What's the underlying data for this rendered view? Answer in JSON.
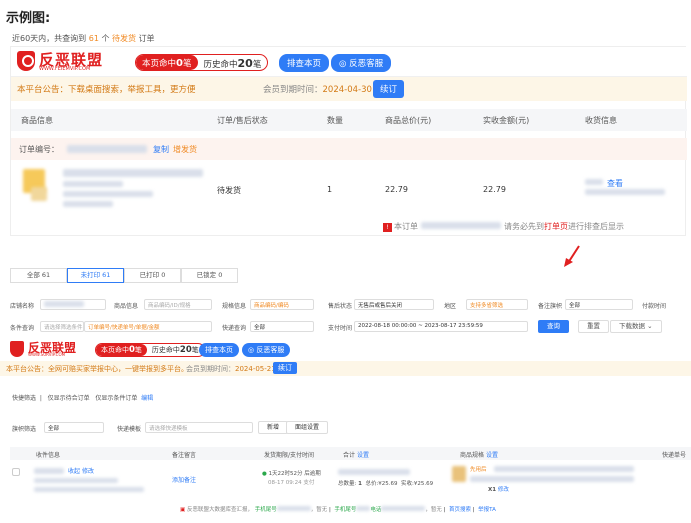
{
  "page_title": "示例图:",
  "summary": {
    "prefix": "近60天内，共查询到",
    "count": "61",
    "middle": "个",
    "status": "待发货",
    "suffix": "订单"
  },
  "brand": {
    "name": "反恶联盟",
    "url": "WWW.FEIEMVIP.COM",
    "accent": "#e02020",
    "blue": "#2f7cf6"
  },
  "hits": {
    "current_prefix": "本页命中",
    "current_count": "0",
    "current_suffix": "笔",
    "history_prefix": "历史命中",
    "history_count": "20",
    "history_suffix": "笔"
  },
  "header_buttons": {
    "check_page": "排查本页",
    "feedback": "反恶客服"
  },
  "notice": {
    "text": "本平台公告：下载桌面搜索，举报工具，更方便",
    "expire_label": "会员到期时间：",
    "expire_date": "2024-04-30",
    "renew": "续订"
  },
  "table_headers": [
    "商品信息",
    "订单/售后状态",
    "数量",
    "商品总价(元)",
    "实收金额(元)",
    "收货信息"
  ],
  "order": {
    "label": "订单编号：",
    "copy": "复制",
    "remark": "增发货",
    "status": "待发货",
    "quantity": "1",
    "total": "22.79",
    "received": "22.79",
    "view": "查看"
  },
  "warning": {
    "prefix": "本订单",
    "middle": "请务必先到",
    "link": "打单页",
    "suffix": "进行排查后显示"
  },
  "tabs": [
    {
      "label": "全部",
      "count": "61"
    },
    {
      "label": "未打印",
      "count": "61"
    },
    {
      "label": "已打印",
      "count": "0"
    },
    {
      "label": "已锁定",
      "count": "0"
    }
  ],
  "filters": {
    "shop_label": "店铺名称",
    "product_label": "商品信息",
    "product_ph": "商品编码/ID/规格",
    "spec_label": "规格信息",
    "spec_ph": "商品编码/编码",
    "refund_label": "售后状态",
    "refund_val": "无售后或售后关闭",
    "region_label": "地区",
    "region_val": "支持多省筛选",
    "remark_label": "备注旗帜",
    "remark_val": "全部",
    "pay_label": "付款时间",
    "cond_label": "条件查询",
    "cond_ph": "请选择筛选条件",
    "cond_val": "订单编号/快递单号/单据/金额",
    "express_label": "快递查询",
    "express_val": "全部",
    "time_label": "支付时间",
    "time_val": "2022-08-18 00:00:00 ~ 2023-08-17 23:59:59",
    "search": "查询",
    "reset": "重置",
    "download": "下载数据"
  },
  "brand2": {
    "name": "反恶联盟",
    "url": "WWW.SURVIP.COM"
  },
  "hits2": {
    "current_prefix": "本页命中",
    "current_count": "0",
    "current_suffix": "笔",
    "history_prefix": "历史命中",
    "history_count": "20",
    "history_suffix": "笔"
  },
  "notice2": {
    "text": "本平台公告：全网可赔买家举报中心，一键举报到多平台。",
    "expire_label": "会员到期时间：",
    "expire_date": "2024-05-21",
    "renew": "续订"
  },
  "filter_tags": {
    "a": "快捷筛选",
    "b": "仅显示待合订单",
    "c": "仅显示条件订单",
    "d": "编辑"
  },
  "list_controls": {
    "flag_label": "旗帜筛选",
    "flag_val": "全部",
    "express_label": "快递模板",
    "express_ph": "请选择快递模板",
    "new": "新增",
    "setting": "面组设置"
  },
  "list_headers": {
    "recv": "收件信息",
    "remark": "备注留言",
    "time": "发货期限/支付时间",
    "total": "合计",
    "total_set": "设置",
    "goods": "商品规格",
    "goods_set": "设置",
    "express": "快递单号"
  },
  "list_row": {
    "edit1": "收起",
    "edit2": "修改",
    "add_remark": "添加备注",
    "deadline": "1天22时52分 后逾期",
    "paytime": "08-17 09:24 支付",
    "total_prefix": "总数量:",
    "total_qty": "1",
    "total_pay_label": "总价:",
    "total_pay": "¥25.69",
    "received_label": "实收:",
    "received": "¥25.69",
    "goods_tag": "先用后",
    "goods_qty": "X1",
    "goods_edit": "修改"
  },
  "bottom": {
    "a": "反恶联盟大数据库查汇报，",
    "b": "手机尾号",
    "c": "，暂无",
    "d": "电话",
    "e": "，暂无",
    "f": "暂无",
    "g": "首页搜索",
    "h": "举报TA"
  }
}
